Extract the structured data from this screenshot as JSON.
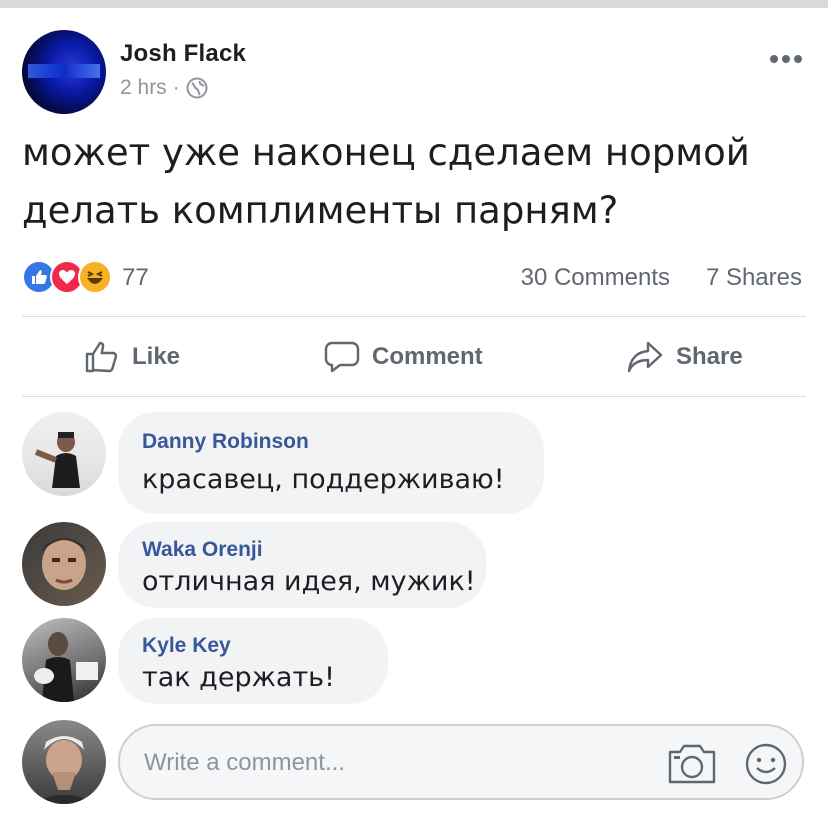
{
  "post": {
    "author": "Josh Flack",
    "time": "2 hrs",
    "separator": "·",
    "text_line1": "может уже наконец сделаем нормой",
    "text_line2": "делать комплименты парням?",
    "reaction_count": "77",
    "comments_count": "30 Comments",
    "shares_count": "7 Shares"
  },
  "actions": {
    "like": "Like",
    "comment": "Comment",
    "share": "Share"
  },
  "comments": [
    {
      "name": "Danny Robinson",
      "text": "красавец, поддерживаю!"
    },
    {
      "name": "Waka Orenji",
      "text": "отличная идея, мужик!"
    },
    {
      "name": "Kyle Key",
      "text": "так держать!"
    }
  ],
  "composer": {
    "placeholder": "Write a comment..."
  },
  "colors": {
    "like_blue": "#3578e5",
    "love_red": "#f0284a",
    "haha_yellow": "#f7b125",
    "name_link": "#385898"
  },
  "icons": [
    "globe-icon",
    "more-icon",
    "like-icon",
    "comment-icon",
    "share-icon",
    "camera-icon",
    "smile-icon"
  ]
}
